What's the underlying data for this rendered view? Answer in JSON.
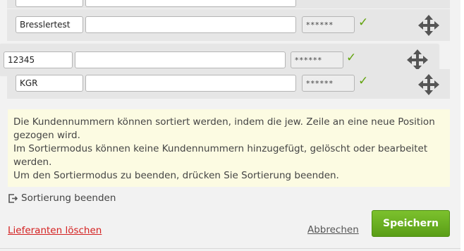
{
  "rows": [
    {
      "customer_number": "Bresslertest",
      "password": "******"
    },
    {
      "customer_number": "12345",
      "password": "******"
    },
    {
      "customer_number": "KGR",
      "password": "******"
    }
  ],
  "check_glyph": "✓",
  "info_lines": [
    "Die Kundennummern können sortiert werden, indem die jew. Zeile an eine neue Position gezogen wird.",
    "Im Sortiermodus können keine Kundennummern hinzugefügt, gelöscht oder bearbeitet werden.",
    "Um den Sortiermodus zu beenden, drücken Sie Sortierung beenden."
  ],
  "sort_end_label": "Sortierung beenden",
  "delete_label": "Lieferanten löschen",
  "cancel_label": "Abbrechen",
  "save_label": "Speichern",
  "colors": {
    "accent": "#62a30e",
    "danger": "#d42020",
    "info_bg": "#fcfbe2"
  },
  "icons": [
    "check-icon",
    "move-icon",
    "exit-icon"
  ]
}
